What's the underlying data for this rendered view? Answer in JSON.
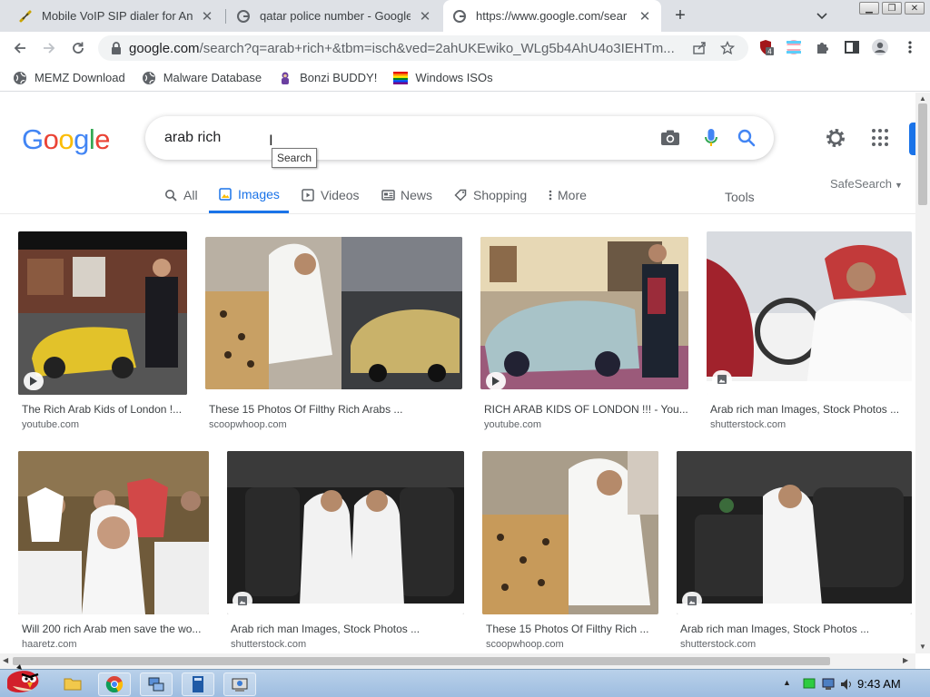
{
  "browser": {
    "tabs": [
      {
        "title": "Mobile VoIP SIP dialer for And",
        "favicon": "phone-handset-icon",
        "active": false
      },
      {
        "title": "qatar police number - Google",
        "favicon": "google-g-icon",
        "active": false
      },
      {
        "title": "https://www.google.com/sear",
        "favicon": "google-g-icon",
        "active": true
      }
    ],
    "new_tab_label": "+",
    "url_main": "google.com",
    "url_rest": "/search?q=arab+rich+&tbm=isch&ved=2ahUKEwiko_WLg5b4AhU4o3IEHTm...",
    "extension_badge": "4"
  },
  "bookmarks": [
    {
      "label": "MEMZ Download",
      "icon": "globe-icon"
    },
    {
      "label": "Malware Database",
      "icon": "globe-icon"
    },
    {
      "label": "Bonzi BUDDY!",
      "icon": "bonzi-icon"
    },
    {
      "label": "Windows ISOs",
      "icon": "rainbow-flag-icon"
    }
  ],
  "google": {
    "logo": [
      "G",
      "o",
      "o",
      "g",
      "l",
      "e"
    ],
    "logo_colors": [
      "#4285F4",
      "#EA4335",
      "#FBBC05",
      "#4285F4",
      "#34A853",
      "#EA4335"
    ],
    "query": "arab rich",
    "search_tooltip": "Search"
  },
  "nav_tabs": [
    {
      "label": "All",
      "icon": "search-icon"
    },
    {
      "label": "Images",
      "icon": "image-icon",
      "selected": true
    },
    {
      "label": "Videos",
      "icon": "play-icon"
    },
    {
      "label": "News",
      "icon": "news-icon"
    },
    {
      "label": "Shopping",
      "icon": "tag-icon"
    },
    {
      "label": "More",
      "icon": "more-vert-icon"
    }
  ],
  "tools_label": "Tools",
  "safesearch_label": "SafeSearch",
  "results": [
    {
      "caption": "The Rich Arab Kids of London !...",
      "source": "youtube.com",
      "badge": "play-icon"
    },
    {
      "caption": "These 15 Photos Of Filthy Rich Arabs ...",
      "source": "scoopwhoop.com",
      "badge": ""
    },
    {
      "caption": "RICH ARAB KIDS OF LONDON !!! - You...",
      "source": "youtube.com",
      "badge": "play-icon"
    },
    {
      "caption": "Arab rich man Images, Stock Photos ...",
      "source": "shutterstock.com",
      "badge": "image-icon"
    },
    {
      "caption": "Will 200 rich Arab men save the wo...",
      "source": "haaretz.com",
      "badge": ""
    },
    {
      "caption": "Arab rich man Images, Stock Photos ...",
      "source": "shutterstock.com",
      "badge": "image-icon"
    },
    {
      "caption": "These 15 Photos Of Filthy Rich ...",
      "source": "scoopwhoop.com",
      "badge": ""
    },
    {
      "caption": "Arab rich man Images, Stock Photos ...",
      "source": "shutterstock.com",
      "badge": "image-icon"
    }
  ],
  "taskbar": {
    "clock": "9:43 AM",
    "apps": [
      "angry-bird-start-icon",
      "folder-icon",
      "chrome-icon",
      "network-computer-icon",
      "notebook-icon",
      "control-panel-icon"
    ]
  }
}
